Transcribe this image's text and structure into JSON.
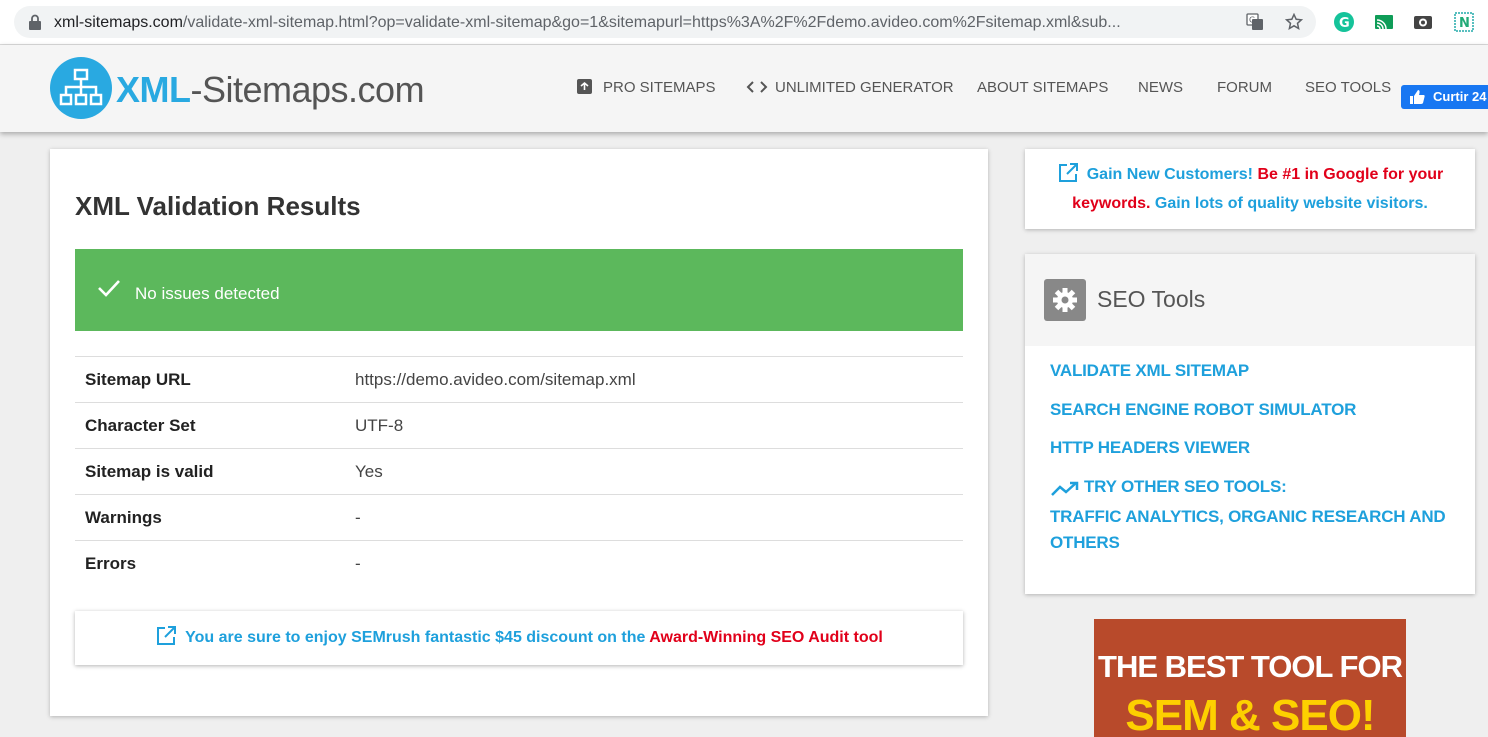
{
  "browser": {
    "url_main": "xml-sitemaps.com",
    "url_rest": "/validate-xml-sitemap.html?op=validate-xml-sitemap&go=1&sitemapurl=https%3A%2F%2Fdemo.avideo.com%2Fsitemap.xml&sub..."
  },
  "header": {
    "logo_part1": "XML",
    "logo_part2": "-Sitemaps.com",
    "nav": {
      "pro": "PRO SITEMAPS",
      "unlimited": "UNLIMITED GENERATOR",
      "about": "ABOUT SITEMAPS",
      "news": "NEWS",
      "forum": "FORUM",
      "seo_tools": "SEO TOOLS"
    },
    "fb_like": "Curtir 24"
  },
  "main": {
    "title": "XML Validation Results",
    "status": "No issues detected",
    "results": [
      {
        "label": "Sitemap URL",
        "value": "https://demo.avideo.com/sitemap.xml"
      },
      {
        "label": "Character Set",
        "value": "UTF-8"
      },
      {
        "label": "Sitemap is valid",
        "value": "Yes"
      },
      {
        "label": "Warnings",
        "value": "-"
      },
      {
        "label": "Errors",
        "value": "-"
      }
    ],
    "promo_blue": "You are sure to enjoy SEMrush fantastic $45 discount on the ",
    "promo_red": "Award-Winning SEO Audit tool"
  },
  "sidebar": {
    "ad": {
      "blue1": "Gain New Customers! ",
      "red": "Be #1 in Google for your keywords. ",
      "blue2": "Gain lots of quality website visitors."
    },
    "tools": {
      "title": "SEO Tools",
      "links": [
        "VALIDATE XML SITEMAP",
        "SEARCH ENGINE ROBOT SIMULATOR",
        "HTTP HEADERS VIEWER",
        "TRY OTHER SEO TOOLS:",
        "TRAFFIC ANALYTICS, ORGANIC RESEARCH AND",
        "OTHERS"
      ]
    },
    "banner": {
      "line1": "THE BEST TOOL FOR",
      "line2": "SEM & SEO!"
    }
  },
  "colors": {
    "accent": "#29a9e1",
    "success": "#5cb85c",
    "link": "#1ea0dc",
    "highlight_red": "#e1001a"
  }
}
